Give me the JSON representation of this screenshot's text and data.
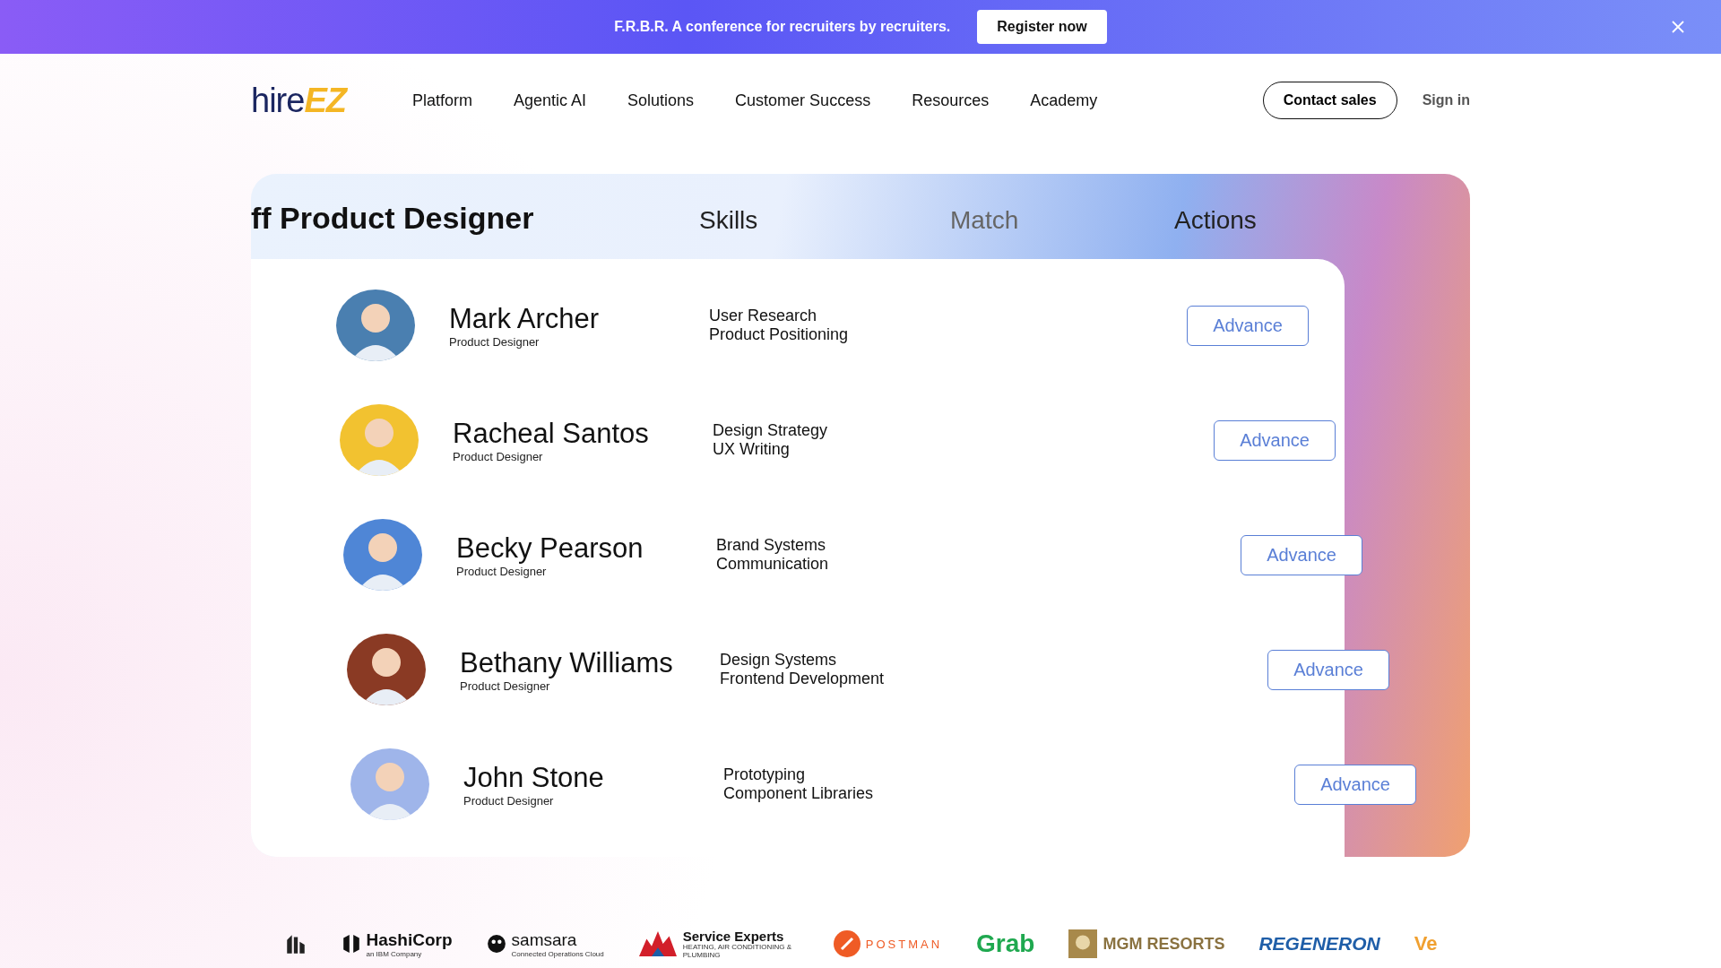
{
  "banner": {
    "text": "F.R.B.R. A conference for recruiters by recruiters.",
    "button": "Register now"
  },
  "nav": {
    "logo_left": "hire",
    "logo_right": "EZ",
    "items": [
      "Platform",
      "Agentic AI",
      "Solutions",
      "Customer Success",
      "Resources",
      "Academy"
    ],
    "contact": "Contact sales",
    "sign_in": "Sign in"
  },
  "table": {
    "title": "ff Product Designer",
    "columns": [
      "Skills",
      "Match",
      "Actions"
    ],
    "rows": [
      {
        "name": "Mark Archer",
        "role": "Product Designer",
        "skills": [
          "User Research",
          "Product Positioning"
        ],
        "action": "Advance",
        "color": "#4a7fb0"
      },
      {
        "name": "Racheal Santos",
        "role": "Product Designer",
        "skills": [
          "Design Strategy",
          "UX Writing"
        ],
        "action": "Advance",
        "color": "#f2c230"
      },
      {
        "name": "Becky Pearson",
        "role": "Product Designer",
        "skills": [
          "Brand Systems",
          "Communication"
        ],
        "action": "Advance",
        "color": "#4f86d6"
      },
      {
        "name": "Bethany Williams",
        "role": "Product Designer",
        "skills": [
          "Design Systems",
          "Frontend Development"
        ],
        "action": "Advance",
        "color": "#8a3a24"
      },
      {
        "name": "John Stone",
        "role": "Product Designer",
        "skills": [
          "Prototyping",
          "Component Libraries"
        ],
        "action": "Advance",
        "color": "#9fb5ea"
      }
    ]
  },
  "logos": [
    {
      "name": "HashiCorp",
      "sub": "an IBM Company"
    },
    {
      "name": "samsara",
      "sub": "Connected Operations Cloud"
    },
    {
      "name": "Service Experts",
      "sub": "HEATING, AIR CONDITIONING & PLUMBING"
    },
    {
      "name": "POSTMAN"
    },
    {
      "name": "Grab"
    },
    {
      "name": "MGM RESORTS"
    },
    {
      "name": "REGENERON"
    },
    {
      "name": "Ve"
    }
  ]
}
